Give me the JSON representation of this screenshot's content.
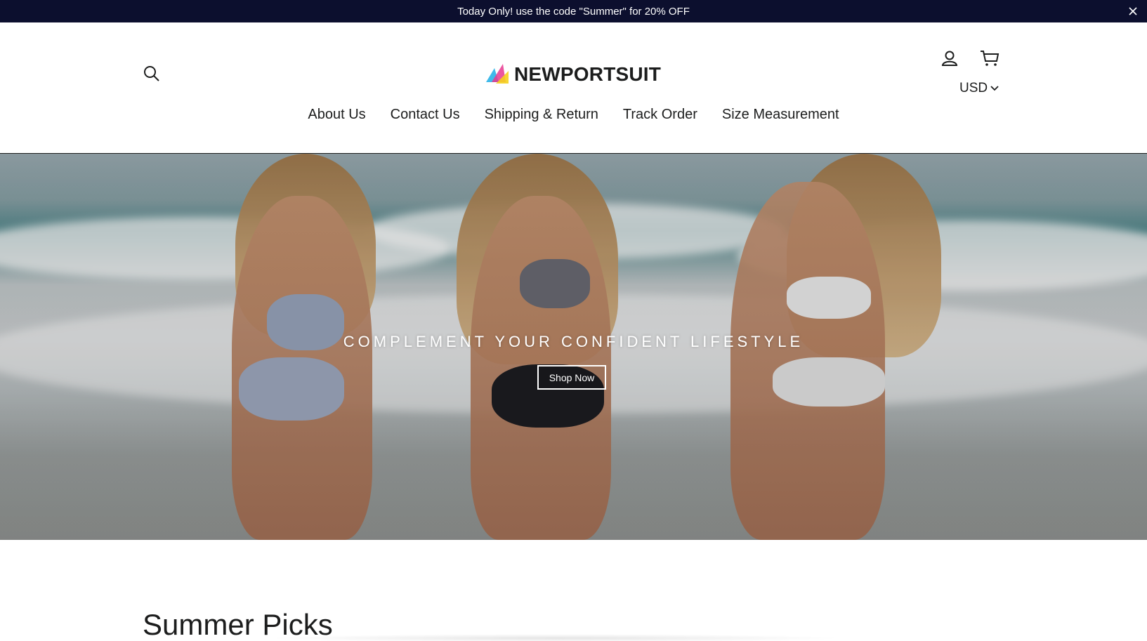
{
  "announcement": {
    "text": "Today Only! use the code \"Summer\" for 20% OFF",
    "close_icon": "close-icon"
  },
  "header": {
    "logo_text": "NEWPORTSUIT",
    "icons": {
      "search": "search-icon",
      "account": "user-icon",
      "cart": "cart-icon"
    },
    "currency": "USD"
  },
  "nav": {
    "items": [
      {
        "label": "About Us"
      },
      {
        "label": "Contact Us"
      },
      {
        "label": "Shipping & Return"
      },
      {
        "label": "Track Order"
      },
      {
        "label": "Size Measurement"
      }
    ]
  },
  "hero": {
    "title": "COMPLEMENT YOUR CONFIDENT LIFESTYLE",
    "button_label": "Shop Now"
  },
  "section": {
    "title": "Summer Picks"
  },
  "colors": {
    "announcement_bg": "#0c0f2e",
    "text": "#1c1d1d",
    "logo_cyan": "#2bb3e8",
    "logo_magenta": "#e8388f",
    "logo_yellow": "#f5d21e"
  }
}
